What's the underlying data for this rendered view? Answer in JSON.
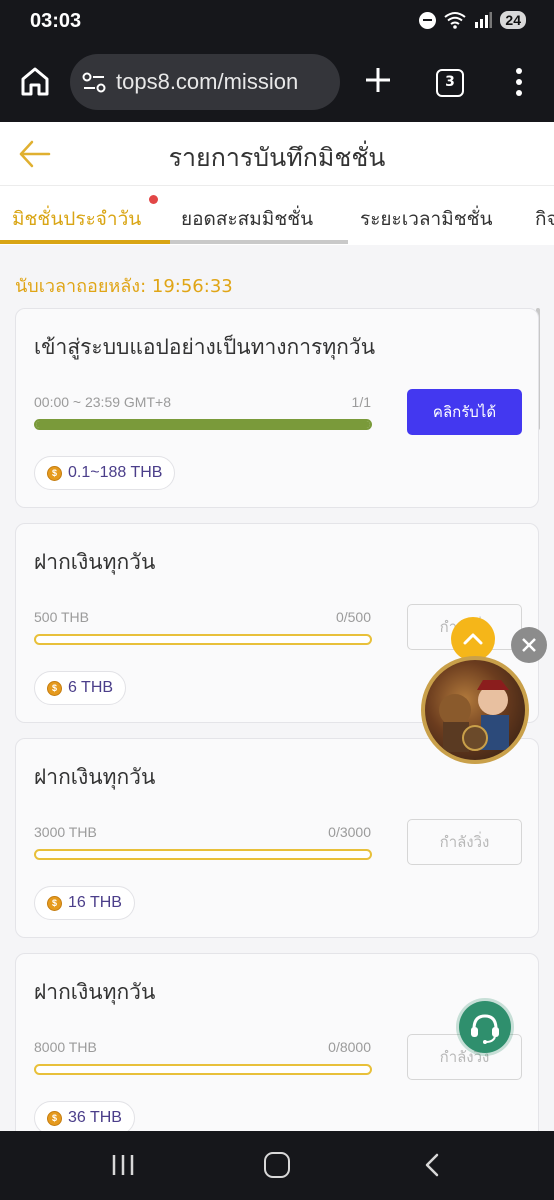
{
  "status_bar": {
    "time": "03:03",
    "battery": "24",
    "icons": [
      "do-not-disturb-icon",
      "wifi-icon",
      "signal-icon",
      "battery-icon"
    ]
  },
  "browser": {
    "url": "tops8.com/mission",
    "tab_count": "3"
  },
  "header": {
    "title": "รายการบันทึกมิชชั่น"
  },
  "tabs": [
    {
      "label": "มิชชั่นประจำวัน",
      "active": true,
      "has_dot": true
    },
    {
      "label": "ยอดสะสมมิชชั่น",
      "active": false
    },
    {
      "label": "ระยะเวลามิชชั่น",
      "active": false
    },
    {
      "label": "กิจ",
      "active": false
    }
  ],
  "countdown": {
    "label": "นับเวลาถอยหลัง:",
    "value": "19:56:33"
  },
  "missions": [
    {
      "title": "เข้าสู่ระบบแอปอย่างเป็นทางการทุกวัน",
      "progress_label": "00:00 ~ 23:59 GMT+8",
      "progress_count": "1/1",
      "progress": 1.0,
      "button": "คลิกรับได้",
      "button_state": "claim",
      "reward": "0.1~188 THB"
    },
    {
      "title": "ฝากเงินทุกวัน",
      "progress_label": "500 THB",
      "progress_count": "0/500",
      "progress": 0.0,
      "button": "กำลังวิ่ง",
      "button_state": "running",
      "reward": "6 THB"
    },
    {
      "title": "ฝากเงินทุกวัน",
      "progress_label": "3000 THB",
      "progress_count": "0/3000",
      "progress": 0.0,
      "button": "กำลังวิ่ง",
      "button_state": "running",
      "reward": "16 THB"
    },
    {
      "title": "ฝากเงินทุกวัน",
      "progress_label": "8000 THB",
      "progress_count": "0/8000",
      "progress": 0.0,
      "button": "กำลังวิ่ง",
      "button_state": "running",
      "reward": "36 THB"
    }
  ],
  "colors": {
    "accent": "#d9a514",
    "claim_button": "#4338f0",
    "progress_fill": "#7a9a3a",
    "progress_border": "#e8c03a",
    "reward_text": "#4b3e8a"
  }
}
